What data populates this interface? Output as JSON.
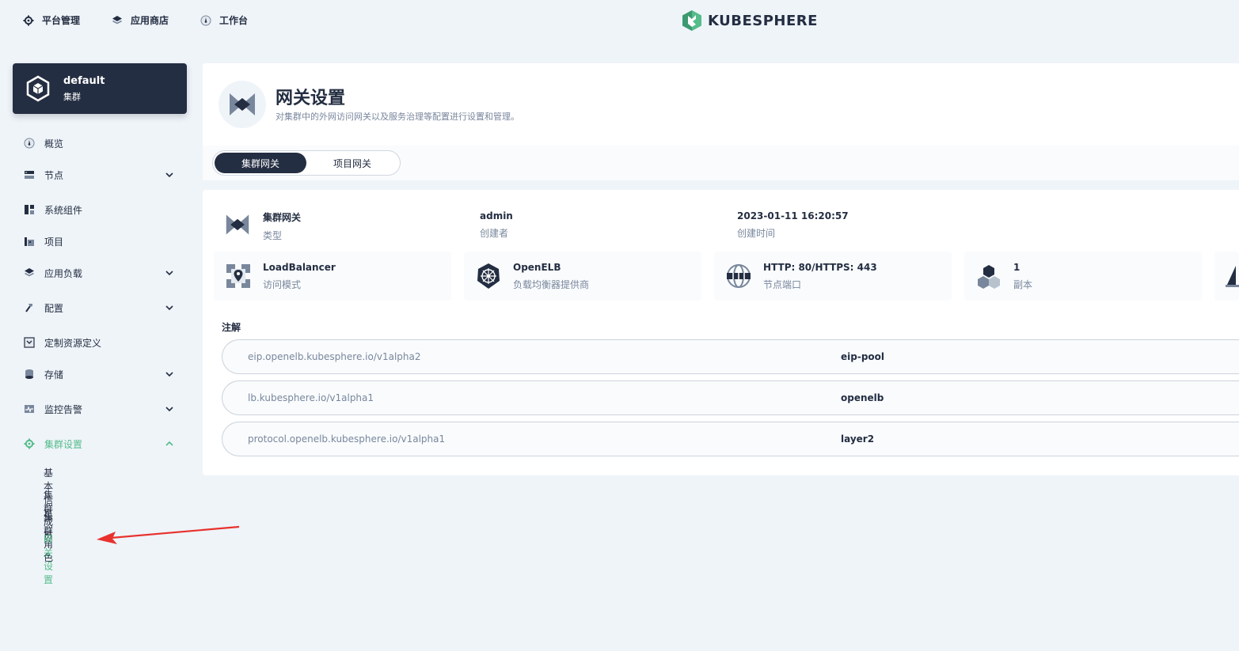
{
  "topnav": {
    "platform": "平台管理",
    "appstore": "应用商店",
    "workbench": "工作台",
    "brand": "KUBESPHERE"
  },
  "cluster": {
    "name": "default",
    "type": "集群"
  },
  "sidebar": {
    "items": [
      {
        "label": "概览"
      },
      {
        "label": "节点"
      },
      {
        "label": "系统组件"
      },
      {
        "label": "项目"
      },
      {
        "label": "应用负载"
      },
      {
        "label": "配置"
      },
      {
        "label": "定制资源定义"
      },
      {
        "label": "存储"
      },
      {
        "label": "监控告警"
      },
      {
        "label": "集群设置"
      }
    ],
    "sub_items": [
      {
        "label": "基本信息"
      },
      {
        "label": "集群成员"
      },
      {
        "label": "集群角色"
      },
      {
        "label": "网关设置"
      }
    ]
  },
  "header": {
    "title": "网关设置",
    "description": "对集群中的外网访问网关以及服务治理等配置进行设置和管理。"
  },
  "tabs": {
    "cluster_gateway": "集群网关",
    "project_gateway": "项目网关"
  },
  "detail": {
    "type_value": "集群网关",
    "type_label": "类型",
    "creator_value": "admin",
    "creator_label": "创建者",
    "created_value": "2023-01-11 16:20:57",
    "created_label": "创建时间",
    "access_mode_value": "LoadBalancer",
    "access_mode_label": "访问模式",
    "provider_value": "OpenELB",
    "provider_label": "负载均衡器提供商",
    "ports_value": "HTTP: 80/HTTPS: 443",
    "ports_label": "节点端口",
    "replicas_value": "1",
    "replicas_label": "副本",
    "annotations_label": "注解",
    "annotations": [
      {
        "key": "eip.openelb.kubesphere.io/v1alpha2",
        "value": "eip-pool"
      },
      {
        "key": "lb.kubesphere.io/v1alpha1",
        "value": "openelb"
      },
      {
        "key": "protocol.openelb.kubesphere.io/v1alpha1",
        "value": "layer2"
      }
    ]
  },
  "colors": {
    "accent": "#55bc8a",
    "dark": "#242e42",
    "muted": "#79879c",
    "arrow": "#e8322d"
  }
}
